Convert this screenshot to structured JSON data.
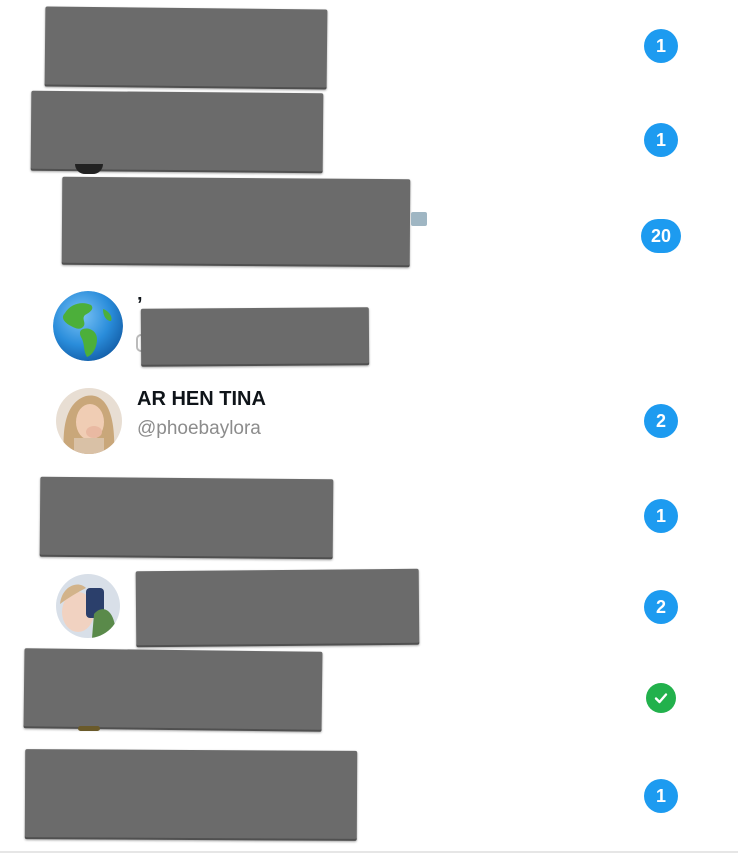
{
  "rows": [
    {
      "badge": "1"
    },
    {
      "badge": "1"
    },
    {
      "badge": "20"
    },
    {
      "badge": "",
      "name_fragment": "’"
    },
    {
      "name": "AR HEN TINA",
      "handle": "@phoebaylora",
      "badge": "2"
    },
    {
      "badge": "1"
    },
    {
      "badge": "2"
    },
    {
      "badge_icon": "check-icon"
    },
    {
      "badge": "1"
    }
  ],
  "colors": {
    "badge_blue": "#1d9bf0",
    "badge_green": "#22b14c",
    "redaction_gray": "#6b6b6b"
  }
}
